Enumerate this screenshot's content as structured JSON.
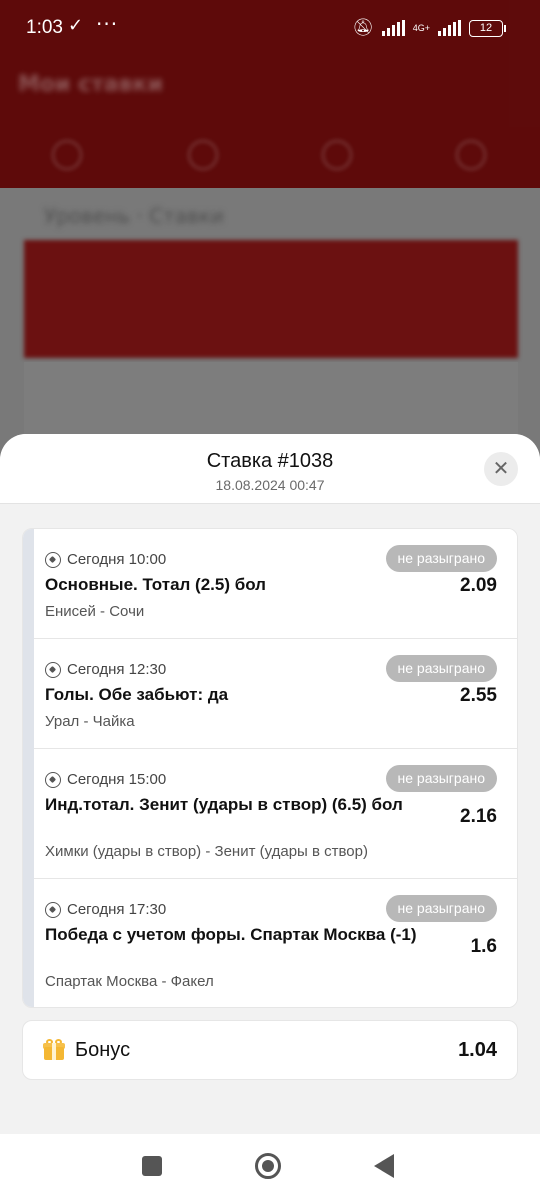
{
  "status_bar": {
    "time": "1:03",
    "network": "4G+",
    "battery": "12"
  },
  "background": {
    "title": "Мои ставки",
    "section": "Уровень · Ставки"
  },
  "sheet": {
    "title": "Ставка #1038",
    "subtitle": "18.08.2024 00:47",
    "close_icon": "close-icon"
  },
  "bets": [
    {
      "time": "Сегодня 10:00",
      "status": "не разыграно",
      "market": "Основные. Тотал (2.5) бол",
      "odds": "2.09",
      "teams": "Енисей - Сочи",
      "icon": "soccer-ball-icon"
    },
    {
      "time": "Сегодня 12:30",
      "status": "не разыграно",
      "market": "Голы. Обе забьют: да",
      "odds": "2.55",
      "teams": "Урал - Чайка",
      "icon": "soccer-ball-icon"
    },
    {
      "time": "Сегодня 15:00",
      "status": "не разыграно",
      "market": "Инд.тотал. Зенит (удары в створ) (6.5) бол",
      "odds": "2.16",
      "teams": "Химки (удары в створ) - Зенит (удары в створ)",
      "icon": "soccer-ball-icon"
    },
    {
      "time": "Сегодня 17:30",
      "status": "не разыграно",
      "market": "Победа с учетом форы. Спартак Москва (-1)",
      "odds": "1.6",
      "teams": "Спартак Москва - Факел",
      "icon": "soccer-ball-icon"
    }
  ],
  "bonus": {
    "label": "Бонус",
    "value": "1.04",
    "icon": "gift-icon"
  },
  "colors": {
    "header_red": "#6b0c0c",
    "pill_grey": "#b8b8b8",
    "gift_yellow": "#f4b733"
  }
}
